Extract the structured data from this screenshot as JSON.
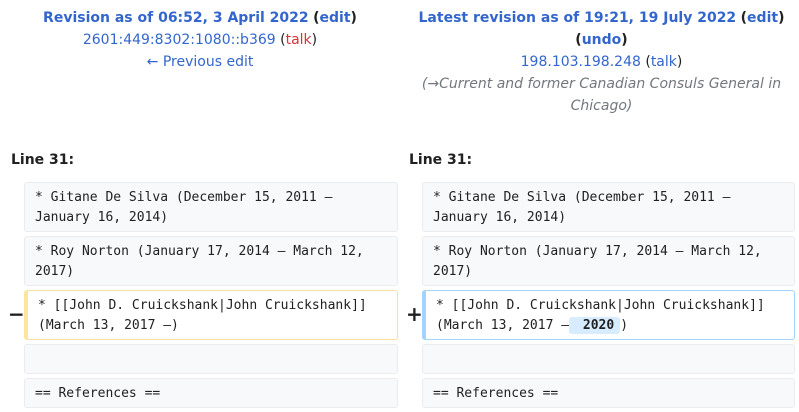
{
  "left_header": {
    "title": "Revision as of 06:52, 3 April 2022",
    "edit": "edit",
    "user": "2601:449:8302:1080::b369",
    "talk": "talk",
    "prev": "← Previous edit"
  },
  "right_header": {
    "title": "Latest revision as of 19:21, 19 July 2022",
    "edit": "edit",
    "undo": "undo",
    "user": "198.103.198.248",
    "talk": "talk",
    "comment_arrow": "→",
    "comment": "Current and former Canadian Consuls General in Chicago"
  },
  "line_label": "Line 31:",
  "rows": [
    {
      "left": "* Gitane De Silva (December 15, 2011 – January 16, 2014)",
      "right": "* Gitane De Silva (December 15, 2011 – January 16, 2014)"
    },
    {
      "left": "* Roy Norton (January 17, 2014 – March 12, 2017)",
      "right": "* Roy Norton (January 17, 2014 – March 12, 2017)"
    },
    {
      "left": "* [[John D. Cruickshank|John Cruickshank]] (March 13, 2017 –)",
      "right_prefix": "* [[John D. Cruickshank|John Cruickshank]] (March 13, 2017 –",
      "right_ins": " 2020",
      "right_suffix": ")"
    },
    {
      "left": "",
      "right": ""
    },
    {
      "left": "== References ==",
      "right": "== References =="
    }
  ],
  "markers": {
    "minus": "−",
    "plus": "+"
  }
}
